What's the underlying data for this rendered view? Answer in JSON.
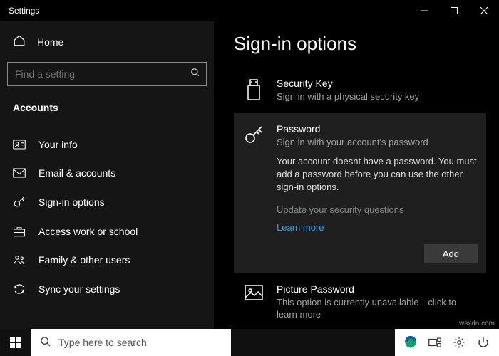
{
  "titlebar": {
    "title": "Settings"
  },
  "sidebar": {
    "home": "Home",
    "search_placeholder": "Find a setting",
    "category": "Accounts",
    "items": [
      {
        "label": "Your info"
      },
      {
        "label": "Email & accounts"
      },
      {
        "label": "Sign-in options"
      },
      {
        "label": "Access work or school"
      },
      {
        "label": "Family & other users"
      },
      {
        "label": "Sync your settings"
      }
    ]
  },
  "main": {
    "heading": "Sign-in options",
    "security_key": {
      "title": "Security Key",
      "sub": "Sign in with a physical security key"
    },
    "password": {
      "title": "Password",
      "sub": "Sign in with your account's password",
      "detail": "Your account doesnt have a password. You must add a password before you can use the other sign-in options.",
      "update": "Update your security questions",
      "learn": "Learn more",
      "add": "Add"
    },
    "picture": {
      "title": "Picture Password",
      "sub": "This option is currently unavailable—click to learn more"
    }
  },
  "taskbar": {
    "search_placeholder": "Type here to search"
  },
  "watermark": "wsxdn.com"
}
